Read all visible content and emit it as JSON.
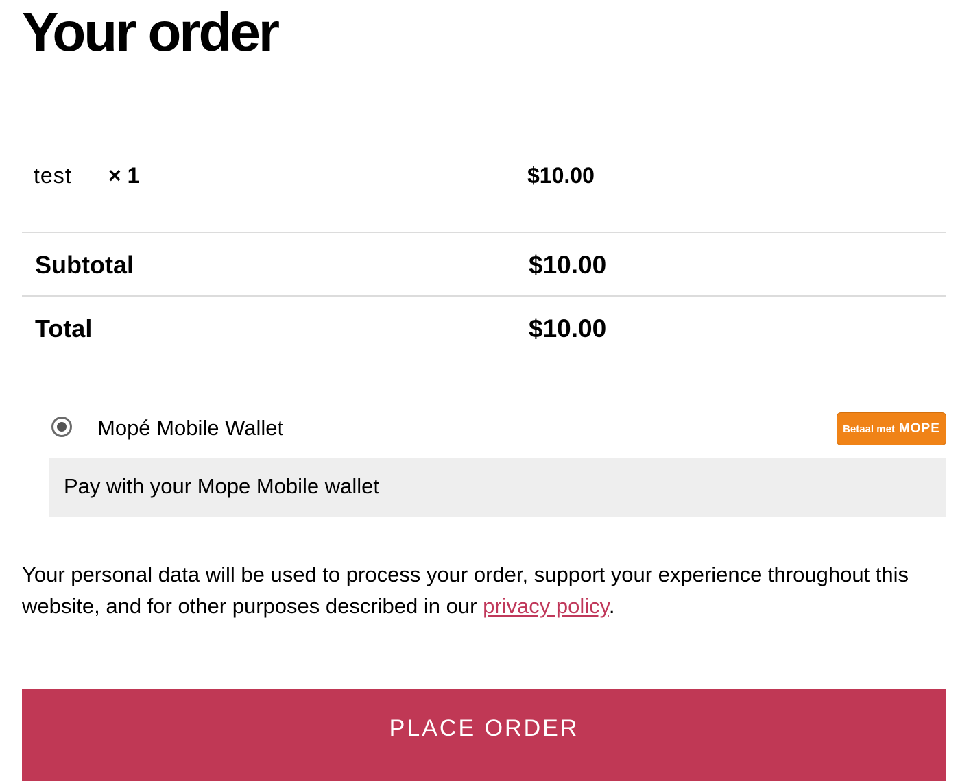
{
  "page": {
    "title": "Your order"
  },
  "order": {
    "item": {
      "name": "test",
      "quantity": "× 1",
      "price": "$10.00"
    },
    "subtotal": {
      "label": "Subtotal",
      "value": "$10.00"
    },
    "total": {
      "label": "Total",
      "value": "$10.00"
    }
  },
  "payment": {
    "method_label": "Mopé Mobile Wallet",
    "description": "Pay with your Mope Mobile wallet",
    "selected": true,
    "badge": {
      "prefix": "Betaal met",
      "brand": "MOPE",
      "color": "#f08317"
    }
  },
  "privacy": {
    "text": "Your personal data will be used to process your order, support your experience throughout this website, and for other purposes described in our ",
    "link_text": "privacy policy",
    "suffix": ".",
    "link_color": "#c0385a"
  },
  "actions": {
    "place_order_label": "PLACE ORDER",
    "button_color": "#c03855"
  }
}
